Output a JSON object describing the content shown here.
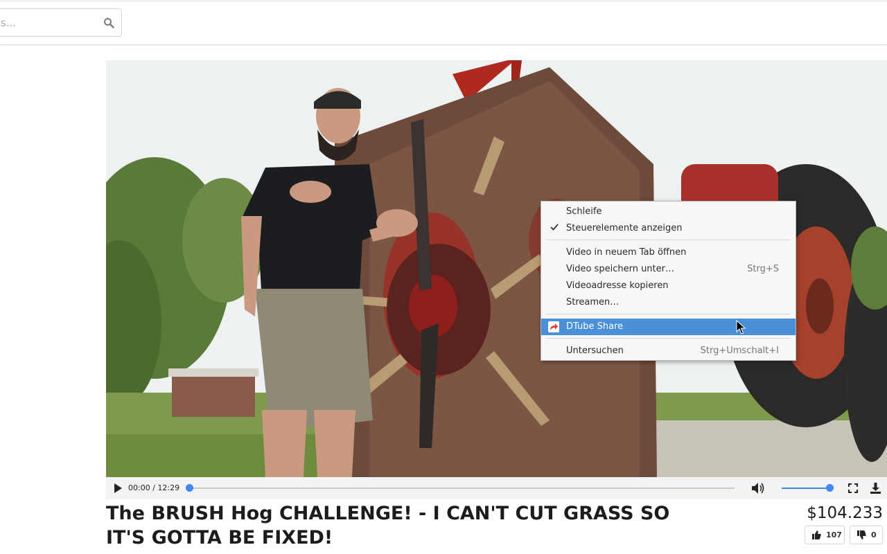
{
  "header": {
    "search_placeholder": "deos..."
  },
  "video": {
    "time_display": "00:00 / 12:29",
    "progress": 0,
    "volume": 1.0
  },
  "title": "The BRUSH Hog CHALLENGE! - I CAN'T CUT GRASS SO IT'S GOTTA BE FIXED!",
  "price": "$104.233",
  "votes": {
    "likes": "107",
    "dislikes": "0"
  },
  "context_menu": {
    "items": [
      {
        "label": "Schleife",
        "shortcut": "",
        "checked": false
      },
      {
        "label": "Steuerelemente anzeigen",
        "shortcut": "",
        "checked": true
      },
      {
        "label": "Video in neuem Tab öffnen",
        "shortcut": ""
      },
      {
        "label": "Video speichern unter…",
        "shortcut": "Strg+S"
      },
      {
        "label": "Videoadresse kopieren",
        "shortcut": ""
      },
      {
        "label": "Streamen…",
        "shortcut": ""
      },
      {
        "label": "DTube Share",
        "shortcut": "",
        "highlighted": true
      },
      {
        "label": "Untersuchen",
        "shortcut": "Strg+Umschalt+I"
      }
    ]
  },
  "colors": {
    "accent": "#4285f4",
    "menu_highlight": "#4a90d9",
    "share_icon": "#e53935"
  }
}
